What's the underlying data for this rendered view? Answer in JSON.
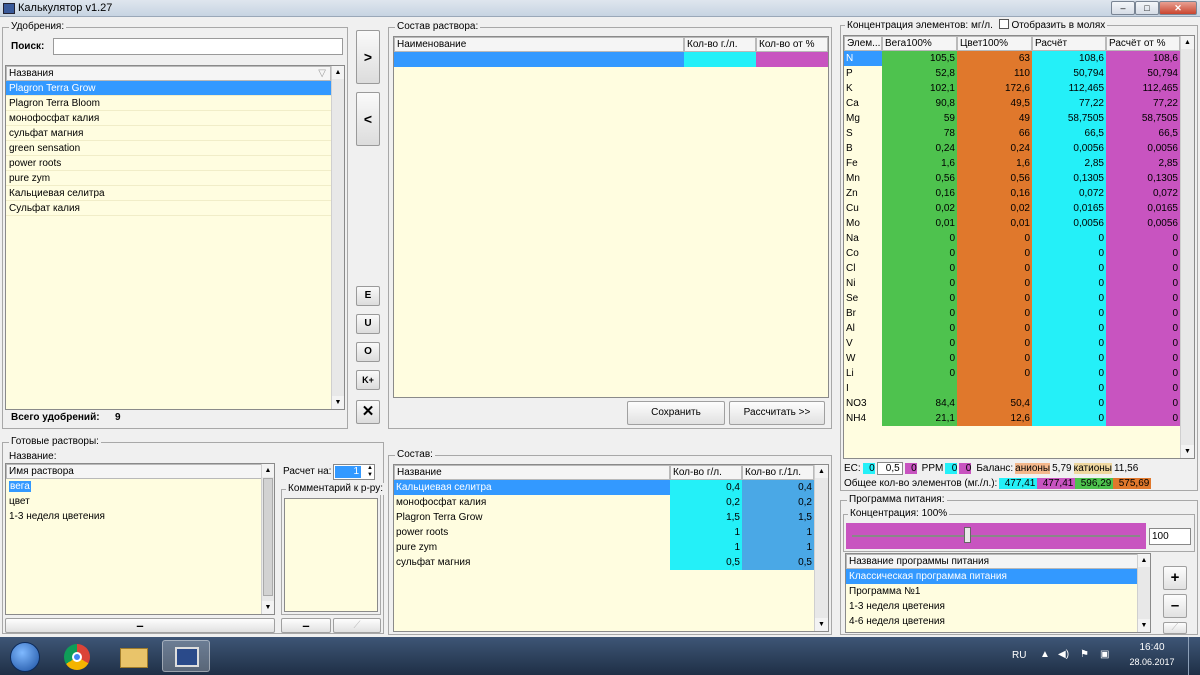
{
  "window": {
    "title": "Калькулятор v1.27",
    "controls": [
      "–",
      "□",
      "✕"
    ]
  },
  "fertilizers": {
    "group": "Удобрения:",
    "search_label": "Поиск:",
    "search_value": "",
    "col_names": "Названия",
    "items": [
      "Plagron Terra Grow",
      "Plagron Terra Bloom",
      "монофосфат калия",
      "сульфат магния",
      "green sensation",
      "power roots",
      "pure zym",
      "Кальциевая селитра",
      "Сульфат калия"
    ],
    "total_label": "Всего удобрений:",
    "total_value": "9"
  },
  "transfer": {
    "add": ">",
    "remove": "<",
    "e": "E",
    "u": "U",
    "o": "O",
    "kplus": "K+",
    "clear": "✕"
  },
  "solution": {
    "group": "Состав раствора:",
    "cols": [
      "Наименование",
      "Кол-во г./л.",
      "Кол-во от %"
    ],
    "save": "Сохранить",
    "calc": "Рассчитать >>"
  },
  "concentration": {
    "group": "Концентрация элементов: мг/л.",
    "checkbox_label": "Отобразить в молях",
    "cols": [
      "Элем...",
      "Вега100%",
      "Цвет100%",
      "Расчёт",
      "Расчёт от %"
    ],
    "rows": [
      [
        "N",
        "105,5",
        "63",
        "108,6",
        "108,6"
      ],
      [
        "P",
        "52,8",
        "110",
        "50,794",
        "50,794"
      ],
      [
        "K",
        "102,1",
        "172,6",
        "112,465",
        "112,465"
      ],
      [
        "Ca",
        "90,8",
        "49,5",
        "77,22",
        "77,22"
      ],
      [
        "Mg",
        "59",
        "49",
        "58,7505",
        "58,7505"
      ],
      [
        "S",
        "78",
        "66",
        "66,5",
        "66,5"
      ],
      [
        "B",
        "0,24",
        "0,24",
        "0,0056",
        "0,0056"
      ],
      [
        "Fe",
        "1,6",
        "1,6",
        "2,85",
        "2,85"
      ],
      [
        "Mn",
        "0,56",
        "0,56",
        "0,1305",
        "0,1305"
      ],
      [
        "Zn",
        "0,16",
        "0,16",
        "0,072",
        "0,072"
      ],
      [
        "Cu",
        "0,02",
        "0,02",
        "0,0165",
        "0,0165"
      ],
      [
        "Mo",
        "0,01",
        "0,01",
        "0,0056",
        "0,0056"
      ],
      [
        "Na",
        "0",
        "0",
        "0",
        "0"
      ],
      [
        "Co",
        "0",
        "0",
        "0",
        "0"
      ],
      [
        "Cl",
        "0",
        "0",
        "0",
        "0"
      ],
      [
        "Ni",
        "0",
        "0",
        "0",
        "0"
      ],
      [
        "Se",
        "0",
        "0",
        "0",
        "0"
      ],
      [
        "Br",
        "0",
        "0",
        "0",
        "0"
      ],
      [
        "Al",
        "0",
        "0",
        "0",
        "0"
      ],
      [
        "V",
        "0",
        "0",
        "0",
        "0"
      ],
      [
        "W",
        "0",
        "0",
        "0",
        "0"
      ],
      [
        "Li",
        "0",
        "0",
        "0",
        "0"
      ],
      [
        "I",
        "",
        "",
        "0",
        "0"
      ],
      [
        "NO3",
        "84,4",
        "50,4",
        "0",
        "0"
      ],
      [
        "NH4",
        "21,1",
        "12,6",
        "0",
        "0"
      ]
    ],
    "ec_label": "EC:",
    "ec_values": [
      "0",
      "0,5",
      "0"
    ],
    "ppm_label": "PPM",
    "ppm_values": [
      "0",
      "0"
    ],
    "balance_label": "Баланс:",
    "anions_label": "анионы",
    "anions_value": "5,79",
    "cations_label": "катионы",
    "cations_value": "11,56",
    "total_label": "Общее кол-во элементов (мг./л.):",
    "totals": [
      "477,41",
      "477,41",
      "596,29",
      "575,69"
    ]
  },
  "ready": {
    "group": "Готовые растворы:",
    "name_group": "Название:",
    "col_name": "Имя раствора",
    "items": [
      "вега",
      "цвет",
      "1-3 неделя цветения"
    ],
    "minus": "–",
    "calc_label": "Расчет на:",
    "calc_value": "1",
    "comment_group": "Комментарий к р-ру:"
  },
  "composition": {
    "group": "Состав:",
    "cols": [
      "Название",
      "Кол-во г/л.",
      "Кол-во г./1л."
    ],
    "rows": [
      [
        "Кальциевая селитра",
        "0,4",
        "0,4"
      ],
      [
        "монофосфат калия",
        "0,2",
        "0,2"
      ],
      [
        "Plagron Terra Grow",
        "1,5",
        "1,5"
      ],
      [
        "power roots",
        "1",
        "1"
      ],
      [
        "pure zym",
        "1",
        "1"
      ],
      [
        "сульфат магния",
        "0,5",
        "0,5"
      ]
    ]
  },
  "program": {
    "group": "Программа питания:",
    "conc_group": "Концентрация: 100%",
    "slider_value": "100",
    "slider_fraction": 0.4,
    "col": "Название программы питания",
    "items": [
      "Классическая программа питания",
      "Программа №1",
      "1-3 неделя цветения",
      "4-6 неделя цветения"
    ],
    "plus": "+",
    "minus": "–"
  },
  "taskbar": {
    "lang": "RU",
    "time": "16:40",
    "date": "28.06.2017"
  }
}
